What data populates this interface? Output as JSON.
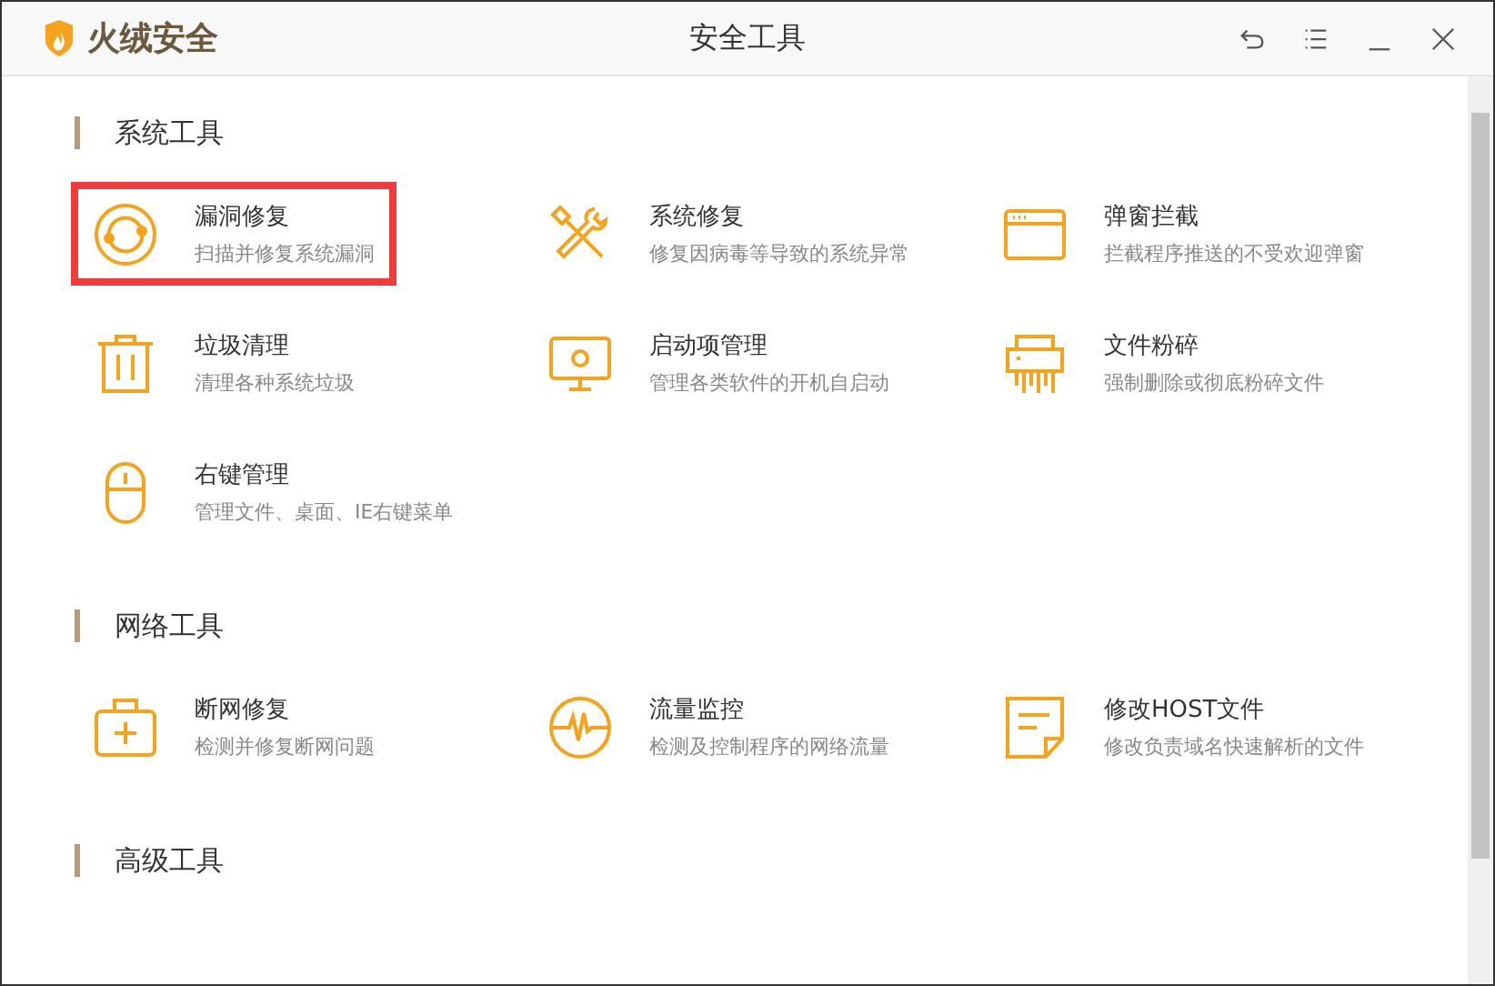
{
  "window": {
    "brand": "火绒安全",
    "title": "安全工具"
  },
  "sections": [
    {
      "title": "系统工具",
      "items": [
        {
          "name": "漏洞修复",
          "desc": "扫描并修复系统漏洞",
          "highlighted": true
        },
        {
          "name": "系统修复",
          "desc": "修复因病毒等导致的系统异常",
          "highlighted": false
        },
        {
          "name": "弹窗拦截",
          "desc": "拦截程序推送的不受欢迎弹窗",
          "highlighted": false
        },
        {
          "name": "垃圾清理",
          "desc": "清理各种系统垃圾",
          "highlighted": false
        },
        {
          "name": "启动项管理",
          "desc": "管理各类软件的开机自启动",
          "highlighted": false
        },
        {
          "name": "文件粉碎",
          "desc": "强制删除或彻底粉碎文件",
          "highlighted": false
        },
        {
          "name": "右键管理",
          "desc": "管理文件、桌面、IE右键菜单",
          "highlighted": false
        }
      ]
    },
    {
      "title": "网络工具",
      "items": [
        {
          "name": "断网修复",
          "desc": "检测并修复断网问题",
          "highlighted": false
        },
        {
          "name": "流量监控",
          "desc": "检测及控制程序的网络流量",
          "highlighted": false
        },
        {
          "name": "修改HOST文件",
          "desc": "修改负责域名快速解析的文件",
          "highlighted": false
        }
      ]
    },
    {
      "title": "高级工具"
    }
  ]
}
